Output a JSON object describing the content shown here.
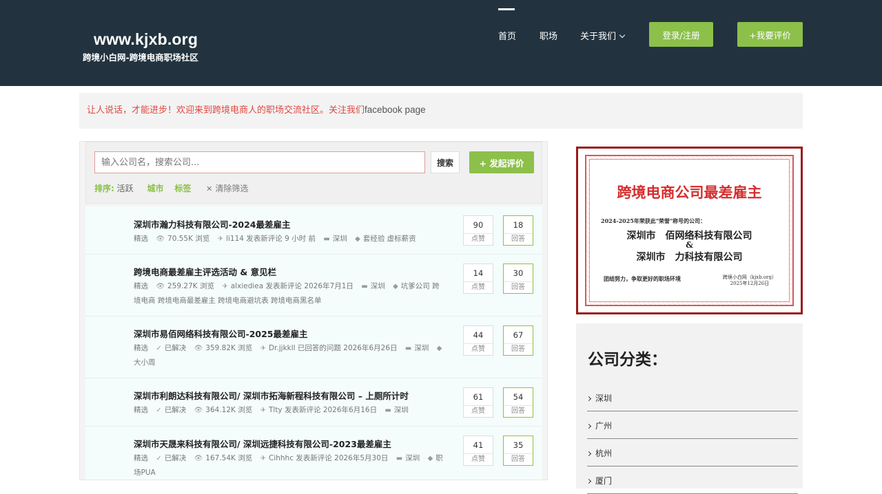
{
  "header": {
    "domain": "www.kjxb.org",
    "tagline": "跨境小白网-跨境电商职场社区",
    "nav": [
      "首页",
      "职场",
      "关于我们"
    ],
    "login_label": "登录/注册",
    "review_label": "+我要评价"
  },
  "notice": {
    "text": "让人说话，才能进步！欢迎来到跨境电商人的职场交流社区。关注我们",
    "link": "facebook page"
  },
  "search": {
    "placeholder": "输入公司名，搜索公司...",
    "button": "搜索",
    "new_button": "+ 发起评价"
  },
  "filter": {
    "label": "排序:",
    "active": "活跃",
    "city": "城市",
    "tag": "标签",
    "clear": "清除筛选"
  },
  "posts": [
    {
      "title": "深圳市瀚力科技有限公司-2024最差雇主",
      "featured": "精选",
      "solved": "",
      "views": "70.55K 浏览",
      "activity": "li114 发表新评论 9 小时 前",
      "city": "深圳",
      "tags": "套经验 虚标薪资",
      "votes": "90",
      "votes_label": "点赞",
      "answers": "18",
      "answers_label": "回答"
    },
    {
      "title": "跨境电商最差雇主评选活动 & 意见栏",
      "featured": "精选",
      "solved": "",
      "views": "259.27K 浏览",
      "activity": "alxiediea 发表新评论 2026年7月1日",
      "city": "深圳",
      "tags": "坑爹公司 跨境电商 跨境电商最差雇主 跨境电商避坑表 跨境电商黑名单",
      "votes": "14",
      "votes_label": "点赞",
      "answers": "30",
      "answers_label": "回答"
    },
    {
      "title": "深圳市易佰网络科技有限公司-2025最差雇主",
      "featured": "精选",
      "solved": "已解决",
      "views": "359.82K 浏览",
      "activity": "Dr.jjkkll 已回答的问题 2026年6月26日",
      "city": "深圳",
      "tags": "大小周",
      "votes": "44",
      "votes_label": "点赞",
      "answers": "67",
      "answers_label": "回答"
    },
    {
      "title": "深圳市利朗达科技有限公司/ 深圳市拓海新程科技有限公司 – 上厕所计时",
      "featured": "精选",
      "solved": "已解决",
      "views": "364.12K 浏览",
      "activity": "Tlty 发表新评论 2026年6月16日",
      "city": "深圳",
      "tags": "",
      "votes": "61",
      "votes_label": "点赞",
      "answers": "54",
      "answers_label": "回答"
    },
    {
      "title": "深圳市天晟来科技有限公司/ 深圳远捷科技有限公司-2023最差雇主",
      "featured": "精选",
      "solved": "已解决",
      "views": "167.54K 浏览",
      "activity": "Cihhhc 发表新评论 2026年5月30日",
      "city": "深圳",
      "tags": "职场PUA",
      "votes": "41",
      "votes_label": "点赞",
      "answers": "35",
      "answers_label": "回答"
    }
  ],
  "award": {
    "title": "跨境电商公司最差雇主",
    "line1": "2024-2025年荣获此\"荣誉\"称号的公司：",
    "company1": "深圳市　佰网络科技有限公司",
    "amp": "&",
    "company2": "深圳市　力科技有限公司",
    "footer_left": "团结努力，争取更好的职场环境",
    "footer_right_1": "跨境小白网（kjxb.org）",
    "footer_right_2": "2025年12月26日"
  },
  "categories": {
    "title": "公司分类：",
    "items": [
      "深圳",
      "广州",
      "杭州",
      "厦门"
    ]
  },
  "colors": {
    "header_bg": "#22333f",
    "accent_green": "#8cc04a",
    "notice_red": "#e0483f",
    "award_red": "#d52e2e"
  }
}
